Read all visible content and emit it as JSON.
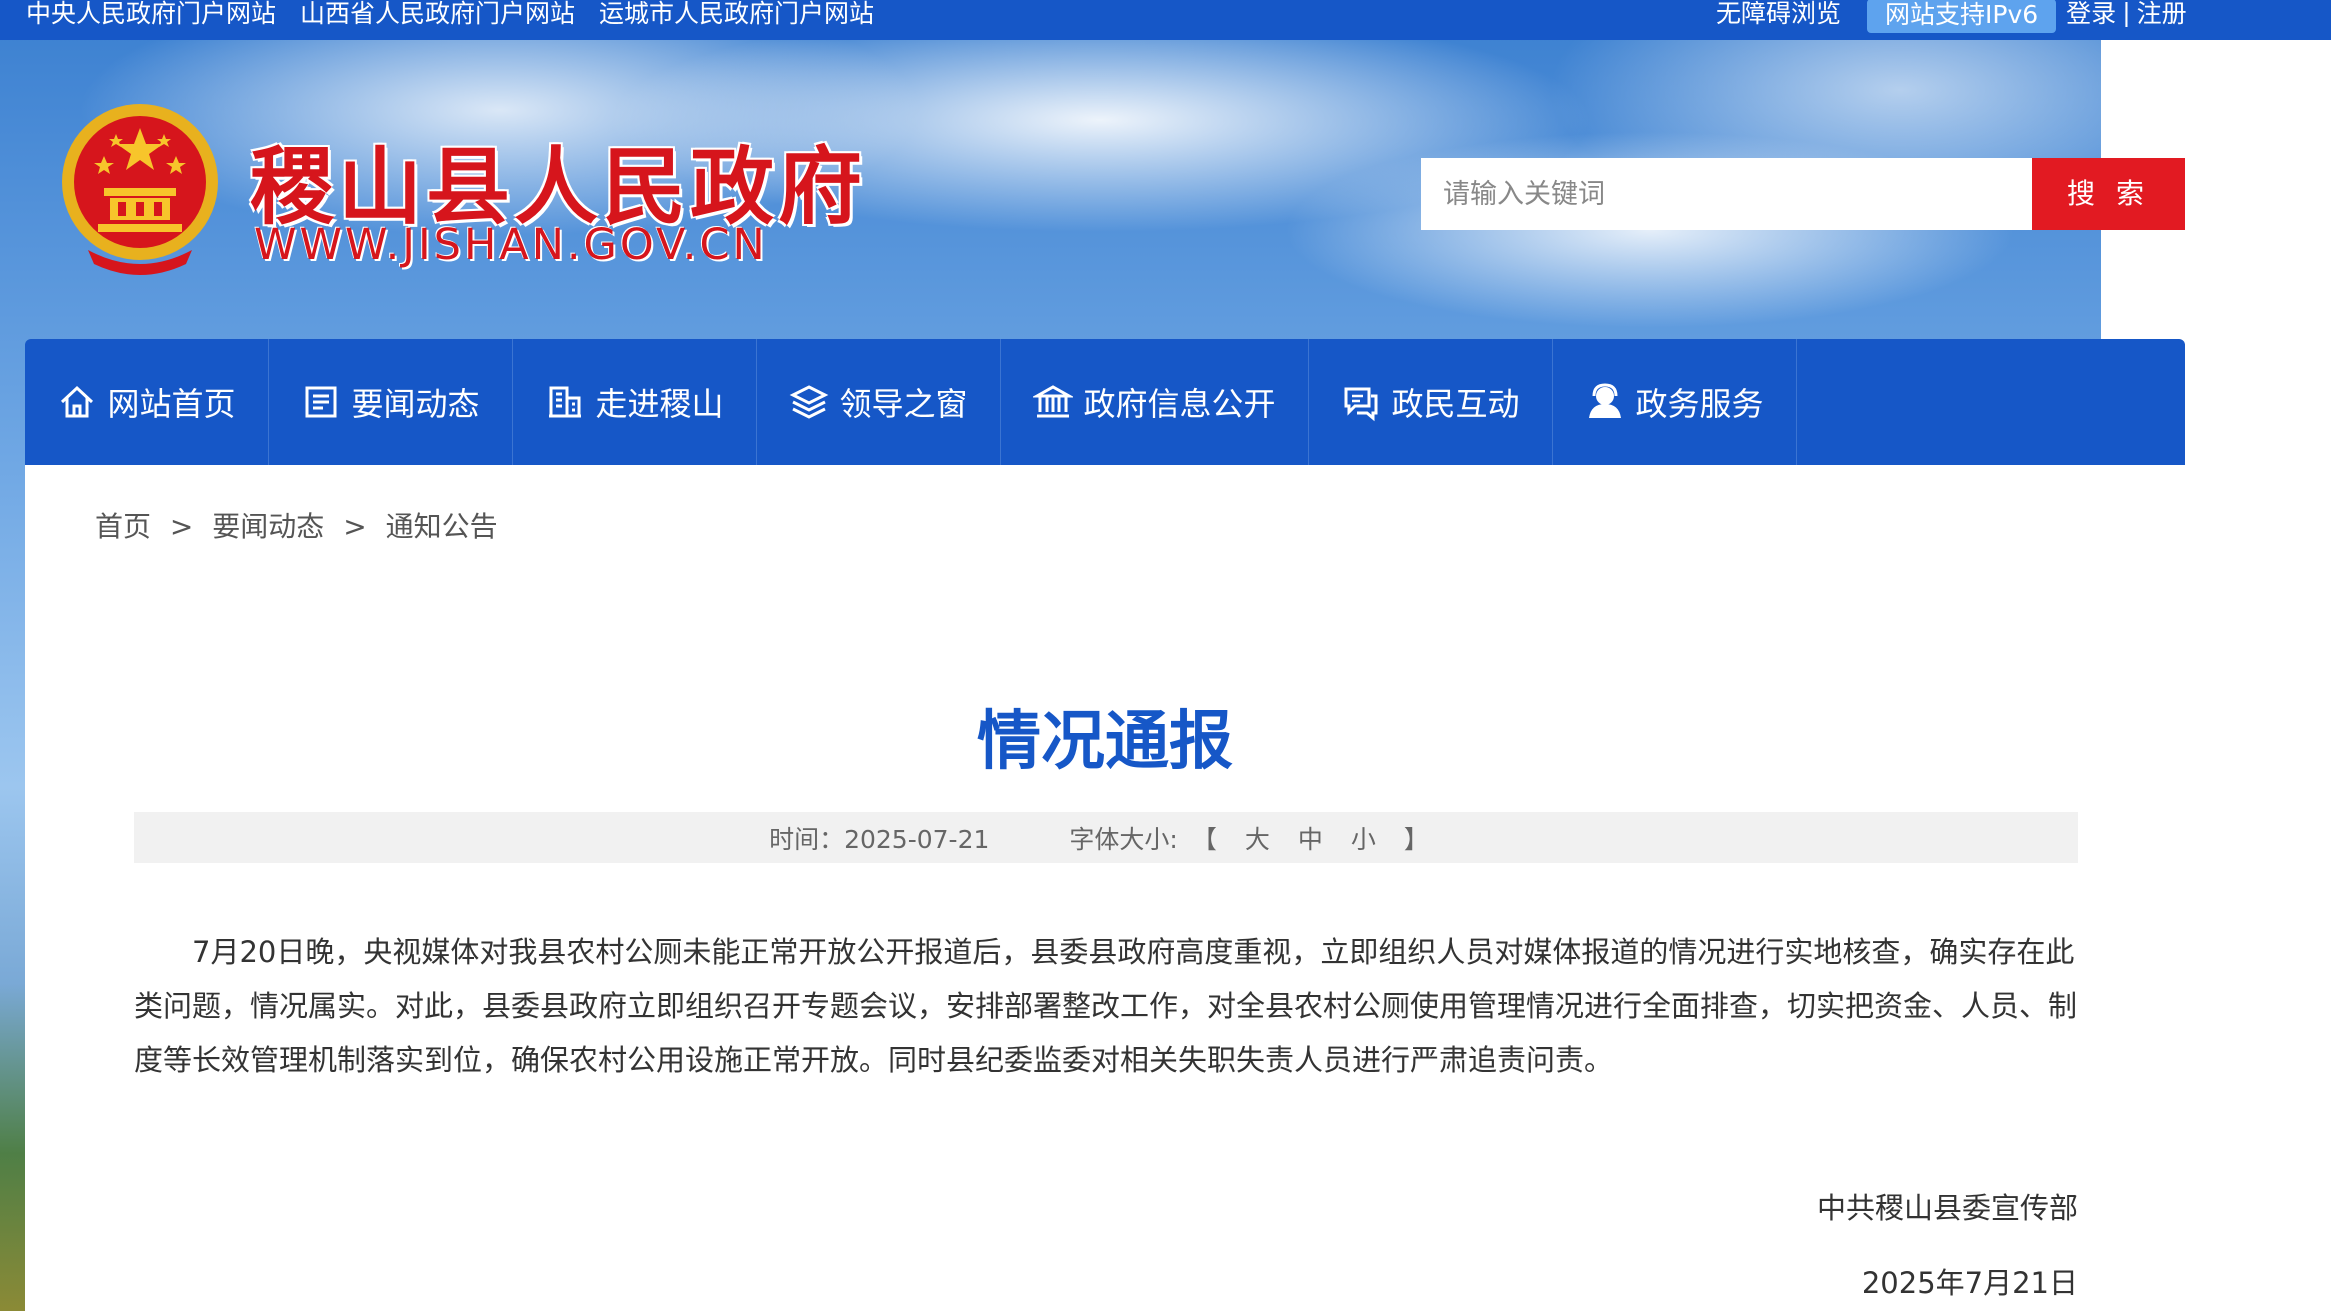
{
  "topbar": {
    "links": [
      "中央人民政府门户网站",
      "山西省人民政府门户网站",
      "运城市人民政府门户网站"
    ],
    "accessibility": "无障碍浏览",
    "ipv6": "网站支持IPv6",
    "login": "登录",
    "divider": "|",
    "register": "注册"
  },
  "header": {
    "title": "稷山县人民政府",
    "url": "WWW.JISHAN.GOV.CN"
  },
  "search": {
    "placeholder": "请输入关键词",
    "button": "搜 索"
  },
  "nav": {
    "items": [
      {
        "label": "网站首页",
        "icon": "home-icon"
      },
      {
        "label": "要闻动态",
        "icon": "news-icon"
      },
      {
        "label": "走进稷山",
        "icon": "building-icon"
      },
      {
        "label": "领导之窗",
        "icon": "layers-icon"
      },
      {
        "label": "政府信息公开",
        "icon": "government-icon"
      },
      {
        "label": "政民互动",
        "icon": "chat-icon"
      },
      {
        "label": "政务服务",
        "icon": "user-service-icon"
      }
    ]
  },
  "breadcrumb": {
    "items": [
      "首页",
      "要闻动态",
      "通知公告"
    ],
    "separator": ">"
  },
  "article": {
    "title": "情况通报",
    "time_label": "时间：2025-07-21",
    "font_size_label": "字体大小:",
    "bracket_open": "【",
    "font_sizes": [
      "大",
      "中",
      "小"
    ],
    "bracket_close": "】",
    "body": "7月20日晚，央视媒体对我县农村公厕未能正常开放公开报道后，县委县政府高度重视，立即组织人员对媒体报道的情况进行实地核查，确实存在此类问题，情况属实。对此，县委县政府立即组织召开专题会议，安排部署整改工作，对全县农村公厕使用管理情况进行全面排查，切实把资金、人员、制度等长效管理机制落实到位，确保农村公用设施正常开放。同时县纪委监委对相关失职失责人员进行严肃追责问责。",
    "signature_org": "中共稷山县委宣传部",
    "signature_date": "2025年7月21日"
  },
  "colors": {
    "primary_blue": "#1657c7",
    "red": "#e21a22",
    "title_red": "#d6151c"
  }
}
